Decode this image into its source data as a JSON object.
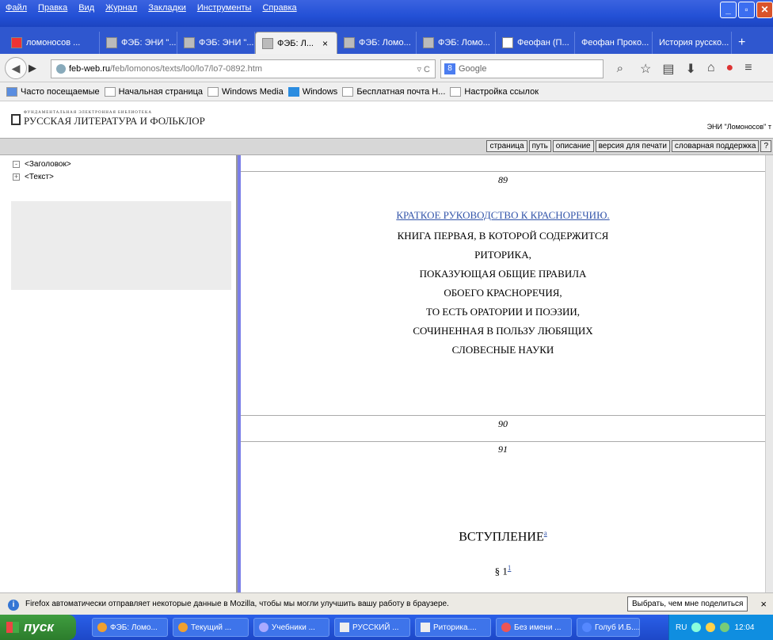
{
  "menu": [
    "Файл",
    "Правка",
    "Вид",
    "Журнал",
    "Закладки",
    "Инструменты",
    "Справка"
  ],
  "tabs": [
    {
      "label": "ломоносов ..."
    },
    {
      "label": "ФЭБ: ЭНИ \"..."
    },
    {
      "label": "ФЭБ: ЭНИ \"..."
    },
    {
      "label": "ФЭБ: Л...",
      "active": true,
      "close": "×"
    },
    {
      "label": "ФЭБ: Ломо..."
    },
    {
      "label": "ФЭБ: Ломо..."
    },
    {
      "label": "Феофан (П..."
    },
    {
      "label": "Феофан Проко..."
    },
    {
      "label": "История русско..."
    }
  ],
  "new_tab": "+",
  "url": {
    "host": "feb-web.ru",
    "path": "/feb/lomonos/texts/lo0/lo7/lo7-0892.htm",
    "reload": "▿ C"
  },
  "search": {
    "engine": "8",
    "placeholder": "Google"
  },
  "bookmarks": [
    "Часто посещаемые",
    "Начальная страница",
    "Windows Media",
    "Windows",
    "Бесплатная почта Н...",
    "Настройка ссылок"
  ],
  "site": {
    "logo_small": "ФУНДАМЕНТАЛЬНАЯ ЭЛЕКТРОННАЯ БИБЛИОТЕКА",
    "logo_big": "РУССКАЯ ЛИТЕРАТУРА И ФОЛЬКЛОР",
    "eni": "ЭНИ \"Ломоносов\" т"
  },
  "toolbar": [
    "страница",
    "путь",
    "описание",
    "версия для печати",
    "словарная поддержка",
    "?"
  ],
  "sidebar": {
    "items": [
      "<Заголовок>",
      "<Текст>"
    ]
  },
  "content": {
    "page_89": "89",
    "link_title": "КРАТКОЕ РУКОВОДСТВО К КРАСНОРЕЧИЮ.",
    "lines": [
      "КНИГА ПЕРВАЯ, В КОТОРОЙ СОДЕРЖИТСЯ",
      "РИТОРИКА,",
      "ПОКАЗУЮЩАЯ ОБЩИЕ ПРАВИЛА",
      "ОБОЕГО КРАСНОРЕЧИЯ,",
      "ТО ЕСТЬ ОРАТОРИИ И ПОЭЗИИ,",
      "СОЧИНЕННАЯ В ПОЛЬЗУ ЛЮБЯЩИХ",
      "СЛОВЕСНЫЕ НАУКИ"
    ],
    "page_90": "90",
    "page_91": "91",
    "heading": "ВСТУПЛЕНИЕ",
    "heading_sup": "а",
    "section": "§ 1",
    "section_sup": "1"
  },
  "notify": {
    "text": "Firefox автоматически отправляет некоторые данные в Mozilla, чтобы мы могли улучшить вашу работу в браузере.",
    "button": "Выбрать, чем мне поделиться",
    "close": "×"
  },
  "taskbar": {
    "start": "пуск",
    "tasks": [
      "ФЭБ: Ломо...",
      "Текущий ...",
      "Учебники ...",
      "РУССКИЙ ...",
      "Риторика....",
      "Без имени ...",
      "Голуб И.Б...."
    ],
    "lang": "RU",
    "time": "12:04"
  }
}
